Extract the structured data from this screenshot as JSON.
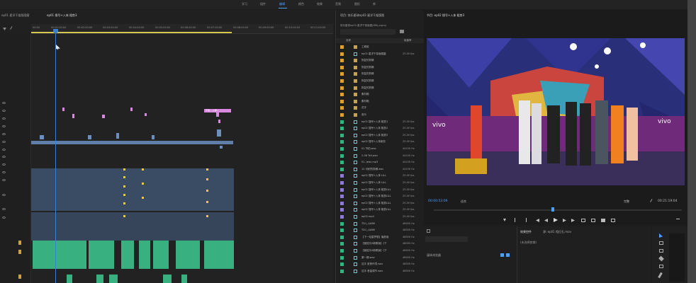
{
  "workspace_tabs": [
    "学习",
    "组件",
    "编辑",
    "颜色",
    "效果",
    "音频",
    "图形",
    "库"
  ],
  "active_workspace": "编辑",
  "timeline": {
    "tabs": [
      "ep01 星洋干架版图磨",
      "ep01 搜号+入体 粗剪3"
    ],
    "ticks": [
      "00:00",
      "00:01:00:00",
      "00:02:00:00",
      "00:03:00:00",
      "00:04:00:00",
      "00:05:00:00",
      "00:06:00:00",
      "00:07:00:00",
      "00:08:00:00",
      "00:09:00:00",
      "00:10:00:00",
      "00:11:00:00"
    ],
    "pink_label": "干架 ...入体..."
  },
  "project": {
    "title": "项目: 快乐星球ep02-星洋干架版图",
    "file": "快乐星球ep02-星洋干架版图(MB).prproj",
    "col_name": "名称",
    "col_rate": "帧速率",
    "items": [
      {
        "name": "工程组",
        "rate": ""
      },
      {
        "name": "ep02 星洋干架版图磨",
        "rate": "25.00 fps"
      },
      {
        "name": "恢复的剪辑",
        "rate": ""
      },
      {
        "name": "恢复的剪辑",
        "rate": ""
      },
      {
        "name": "恢复的剪辑",
        "rate": ""
      },
      {
        "name": "恢复的剪辑",
        "rate": ""
      },
      {
        "name": "恢复的剪辑",
        "rate": ""
      },
      {
        "name": "素材箱",
        "rate": ""
      },
      {
        "name": "素材箱",
        "rate": ""
      },
      {
        "name": "花字",
        "rate": ""
      },
      {
        "name": "音乐",
        "rate": ""
      },
      {
        "name": "ep02 搜号+入体 粗剪1",
        "rate": "25.00 fps"
      },
      {
        "name": "ep02 搜号+入体 粗剪2",
        "rate": "25.00 fps"
      },
      {
        "name": "ep02 搜号+入体 粗剪3",
        "rate": "25.00 fps"
      },
      {
        "name": "ep02 搜号+入体新剪",
        "rate": "25.00 fps"
      },
      {
        "name": "01 节拍.wav",
        "rate": "44100 Hz"
      },
      {
        "name": "2-08 Tell.wav",
        "rate": "44100 Hz"
      },
      {
        "name": "01. Jean.mp3",
        "rate": "44100 Hz"
      },
      {
        "name": "12 可耐的剪辑.wav",
        "rate": "44100 Hz"
      },
      {
        "name": "ep02 搜号+入体 L&L",
        "rate": "25.00 fps"
      },
      {
        "name": "ep02 搜号+入体 L&L",
        "rate": "25.00 fps"
      },
      {
        "name": "ep02 搜号+入体 粗剪L&L",
        "rate": "25.00 fps"
      },
      {
        "name": "ep02 搜号+入体 粗剪L&L",
        "rate": "25.00 fps"
      },
      {
        "name": "ep02 搜号+入体 粗剪L&L",
        "rate": "25.00 fps"
      },
      {
        "name": "ep02 搜号+入体 粗剪L&L",
        "rate": "25.00 fps"
      },
      {
        "name": "ep02.mp4",
        "rate": "25.00 fps"
      },
      {
        "name": "TD1_LANM",
        "rate": "48000 Hz"
      },
      {
        "name": "TD1_LANM",
        "rate": "48000 Hz"
      },
      {
        "name": "【下一站星梦想】播放版",
        "rate": "48000 Hz"
      },
      {
        "name": "【管弦乐X新歌版】《下",
        "rate": "48000 Hz"
      },
      {
        "name": "【管弦乐X新歌版】《下",
        "rate": "48000 Hz"
      },
      {
        "name": "第一期.wav",
        "rate": "48000 Hz"
      },
      {
        "name": "这手 夏夜环境.wav",
        "rate": "48000 Hz"
      },
      {
        "name": "这手 音量调节.wav",
        "rate": "48000 Hz"
      }
    ]
  },
  "monitor": {
    "title": "节目: ep02 搜号+入体 粗剪3",
    "timecode": "00:00:53:09",
    "fit": "适合",
    "zoom": "完整",
    "duration": "00:21:19:04",
    "vivo": "vivo"
  },
  "effects": {
    "tab": "效果控件",
    "clip": "源: ep01 相位孔.mov",
    "empty": "(未选择剪辑)"
  },
  "bottom_left": {
    "label": "媒体浏览器"
  },
  "colors": {
    "accent": "#4aa0ff",
    "audio": "#39b07f",
    "label_pink": "#d88adf"
  }
}
